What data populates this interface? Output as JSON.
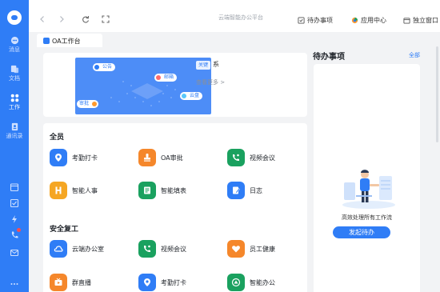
{
  "rail": {
    "items": [
      {
        "label": "消息",
        "icon": "message-icon"
      },
      {
        "label": "文档",
        "icon": "document-icon"
      },
      {
        "label": "工作",
        "icon": "work-grid-icon"
      },
      {
        "label": "通讯录",
        "icon": "contacts-icon"
      }
    ],
    "lower_icons": [
      "calendar-icon",
      "check-icon",
      "lightning-icon",
      "phone-icon",
      "mail-icon",
      "more-icon"
    ]
  },
  "topbar": {
    "title": "云端智能办公平台",
    "todo_label": "待办事项",
    "app_center_label": "应用中心",
    "standalone_label": "独立窗口"
  },
  "tab": {
    "label": "OA工作台"
  },
  "banner": {
    "chips": [
      "公告",
      "邮箱",
      "云盘",
      "审批"
    ],
    "notice_tag": "关键",
    "notice_text": "系",
    "more_label": "查看更多 >"
  },
  "sections": [
    {
      "title": "全员",
      "apps": [
        {
          "name": "考勤打卡",
          "icon": "location-icon",
          "color": "#2f7df6"
        },
        {
          "name": "OA审批",
          "icon": "stamp-icon",
          "color": "#f5872b"
        },
        {
          "name": "视频会议",
          "icon": "video-call-icon",
          "color": "#1aa15f"
        },
        {
          "name": "智能人事",
          "icon": "hr-icon",
          "color": "#f5a623"
        },
        {
          "name": "智能填表",
          "icon": "form-icon",
          "color": "#1aa15f"
        },
        {
          "name": "日志",
          "icon": "log-icon",
          "color": "#2f7df6"
        }
      ]
    },
    {
      "title": "安全复工",
      "apps": [
        {
          "name": "云端办公室",
          "icon": "cloud-office-icon",
          "color": "#2f7df6"
        },
        {
          "name": "视频会议",
          "icon": "video-call-icon",
          "color": "#1aa15f"
        },
        {
          "name": "员工健康",
          "icon": "heart-icon",
          "color": "#f5872b"
        },
        {
          "name": "群直播",
          "icon": "live-icon",
          "color": "#f5872b"
        },
        {
          "name": "考勤打卡",
          "icon": "location-icon",
          "color": "#2f7df6"
        },
        {
          "name": "智能办公",
          "icon": "smart-office-icon",
          "color": "#1aa15f"
        }
      ]
    }
  ],
  "todo": {
    "title": "待办事项",
    "all_label": "全部",
    "empty_text": "高效处理所有工作流",
    "button_label": "发起待办"
  },
  "colors": {
    "primary": "#2f7df6",
    "background": "#f2f3f5"
  }
}
